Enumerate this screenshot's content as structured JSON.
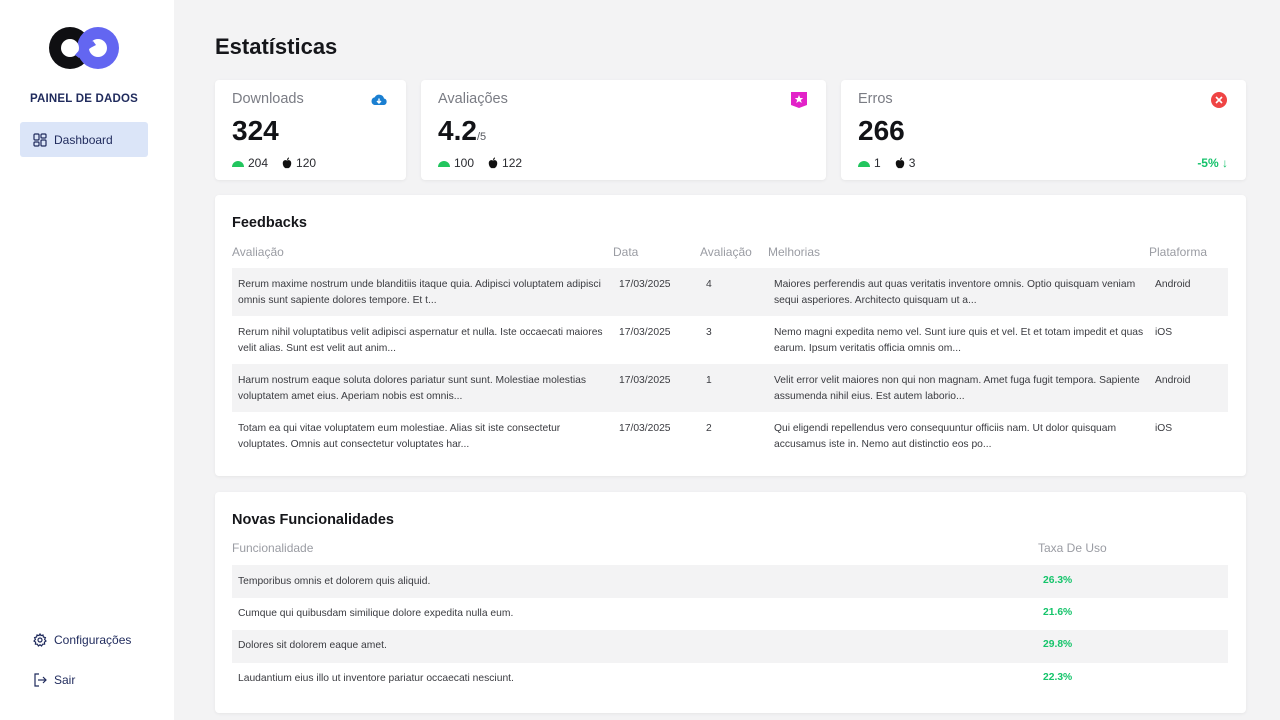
{
  "sidebar": {
    "brand": "PAINEL DE DADOS",
    "nav": [
      {
        "label": "Dashboard",
        "icon": "dashboard-icon",
        "active": true
      },
      {
        "label": "Configurações",
        "icon": "gear-icon"
      },
      {
        "label": "Sair",
        "icon": "logout-icon"
      }
    ]
  },
  "page": {
    "title": "Estatísticas"
  },
  "stats": {
    "downloads": {
      "title": "Downloads",
      "value": "324",
      "android": "204",
      "ios": "120",
      "icon": "cloud-download-icon",
      "icon_color": "#1a7fd1"
    },
    "ratings": {
      "title": "Avaliações",
      "value": "4.2",
      "suffix": "/5",
      "android": "100",
      "ios": "122",
      "icon": "star-badge-icon",
      "icon_color": "#e222c8"
    },
    "errors": {
      "title": "Erros",
      "value": "266",
      "android": "1",
      "ios": "3",
      "delta": "-5% ↓",
      "icon": "error-circle-icon",
      "icon_color": "#ef4444"
    }
  },
  "feedbacks": {
    "title": "Feedbacks",
    "columns": [
      "Avaliação",
      "Data",
      "Avaliação",
      "Melhorias",
      "Plataforma"
    ],
    "rows": [
      {
        "text1": "Rerum maxime nostrum unde blanditiis itaque quia. Adipisci voluptatem adipisci",
        "text2": "omnis sunt sapiente dolores tempore. Et t...",
        "date": "17/03/2025",
        "score": "4",
        "imp1": "Maiores perferendis aut quas veritatis inventore omnis. Optio quisquam veniam",
        "imp2": "sequi asperiores. Architecto quisquam ut a...",
        "platform": "Android"
      },
      {
        "text1": "Rerum nihil voluptatibus velit adipisci aspernatur et nulla. Iste occaecati maiores",
        "text2": "velit alias. Sunt est velit aut anim...",
        "date": "17/03/2025",
        "score": "3",
        "imp1": "Nemo magni expedita nemo vel. Sunt iure quis et vel. Et et totam impedit et quas",
        "imp2": "earum. Ipsum veritatis officia omnis om...",
        "platform": "iOS"
      },
      {
        "text1": "Harum nostrum eaque soluta dolores pariatur sunt sunt. Molestiae molestias",
        "text2": "voluptatem amet eius. Aperiam nobis est omnis...",
        "date": "17/03/2025",
        "score": "1",
        "imp1": "Velit error velit maiores non qui non magnam. Amet fuga fugit tempora. Sapiente",
        "imp2": "assumenda nihil eius. Est autem laborio...",
        "platform": "Android"
      },
      {
        "text1": "Totam ea qui vitae voluptatem eum molestiae. Alias sit iste consectetur",
        "text2": "voluptates. Omnis aut consectetur voluptates har...",
        "date": "17/03/2025",
        "score": "2",
        "imp1": "Qui eligendi repellendus vero consequuntur officiis nam. Ut dolor quisquam",
        "imp2": "accusamus iste in. Nemo aut distinctio eos po...",
        "platform": "iOS"
      }
    ]
  },
  "features": {
    "title": "Novas Funcionalidades",
    "columns": [
      "Funcionalidade",
      "Taxa De Uso"
    ],
    "rows": [
      {
        "name": "Temporibus omnis et dolorem quis aliquid.",
        "rate": "26.3%"
      },
      {
        "name": "Cumque qui quibusdam similique dolore expedita nulla eum.",
        "rate": "21.6%"
      },
      {
        "name": "Dolores sit dolorem eaque amet.",
        "rate": "29.8%"
      },
      {
        "name": "Laudantium eius illo ut inventore pariatur occaecati nesciunt.",
        "rate": "22.3%"
      }
    ]
  }
}
